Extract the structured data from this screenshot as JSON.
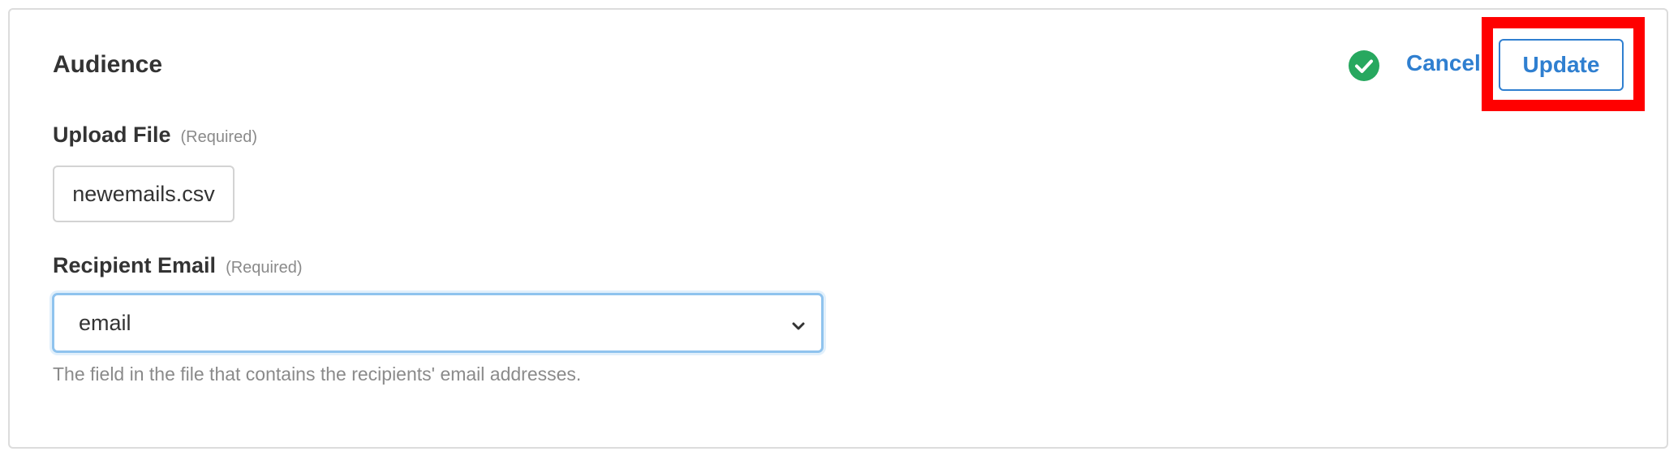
{
  "section": {
    "title": "Audience"
  },
  "header_actions": {
    "status_icon": "check-circle-icon",
    "status_color": "#27a85f",
    "cancel_label": "Cancel",
    "update_label": "Update",
    "accent_color": "#2f7fd0",
    "highlight_color": "#ff0000"
  },
  "upload_file": {
    "label": "Upload File",
    "required_text": "(Required)",
    "file_name": "newemails.csv"
  },
  "recipient_email": {
    "label": "Recipient Email",
    "required_text": "(Required)",
    "selected_value": "email",
    "icon": "chevron-down-icon",
    "help_text": "The field in the file that contains the recipients' email addresses."
  }
}
